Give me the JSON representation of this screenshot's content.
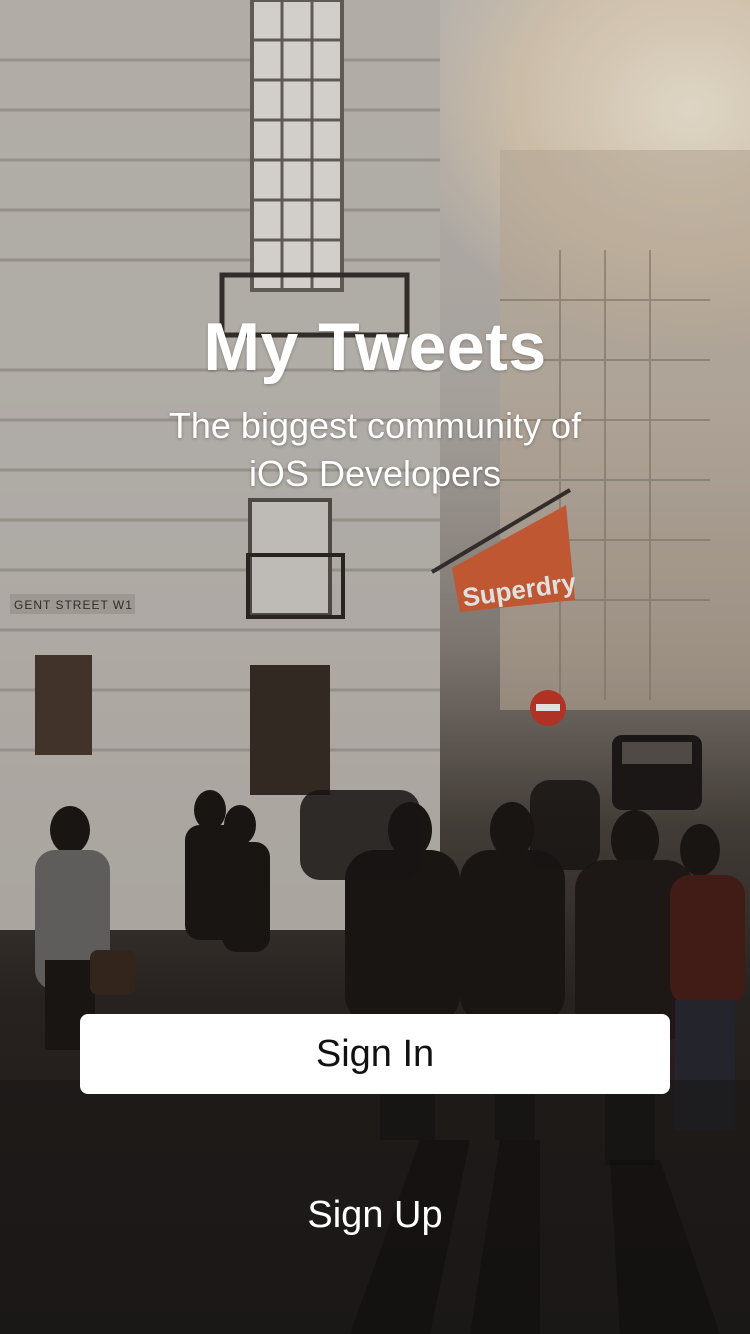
{
  "app": {
    "title": "My Tweets",
    "subtitle_line1": "The biggest community of",
    "subtitle_line2": "iOS Developers"
  },
  "background": {
    "street_sign": "GENT STREET W1",
    "store_sign": "Superdry"
  },
  "actions": {
    "sign_in_label": "Sign In",
    "sign_up_label": "Sign Up"
  },
  "colors": {
    "button_bg": "#ffffff",
    "button_text": "#111111",
    "text": "#ffffff",
    "flag": "#d9643a"
  }
}
